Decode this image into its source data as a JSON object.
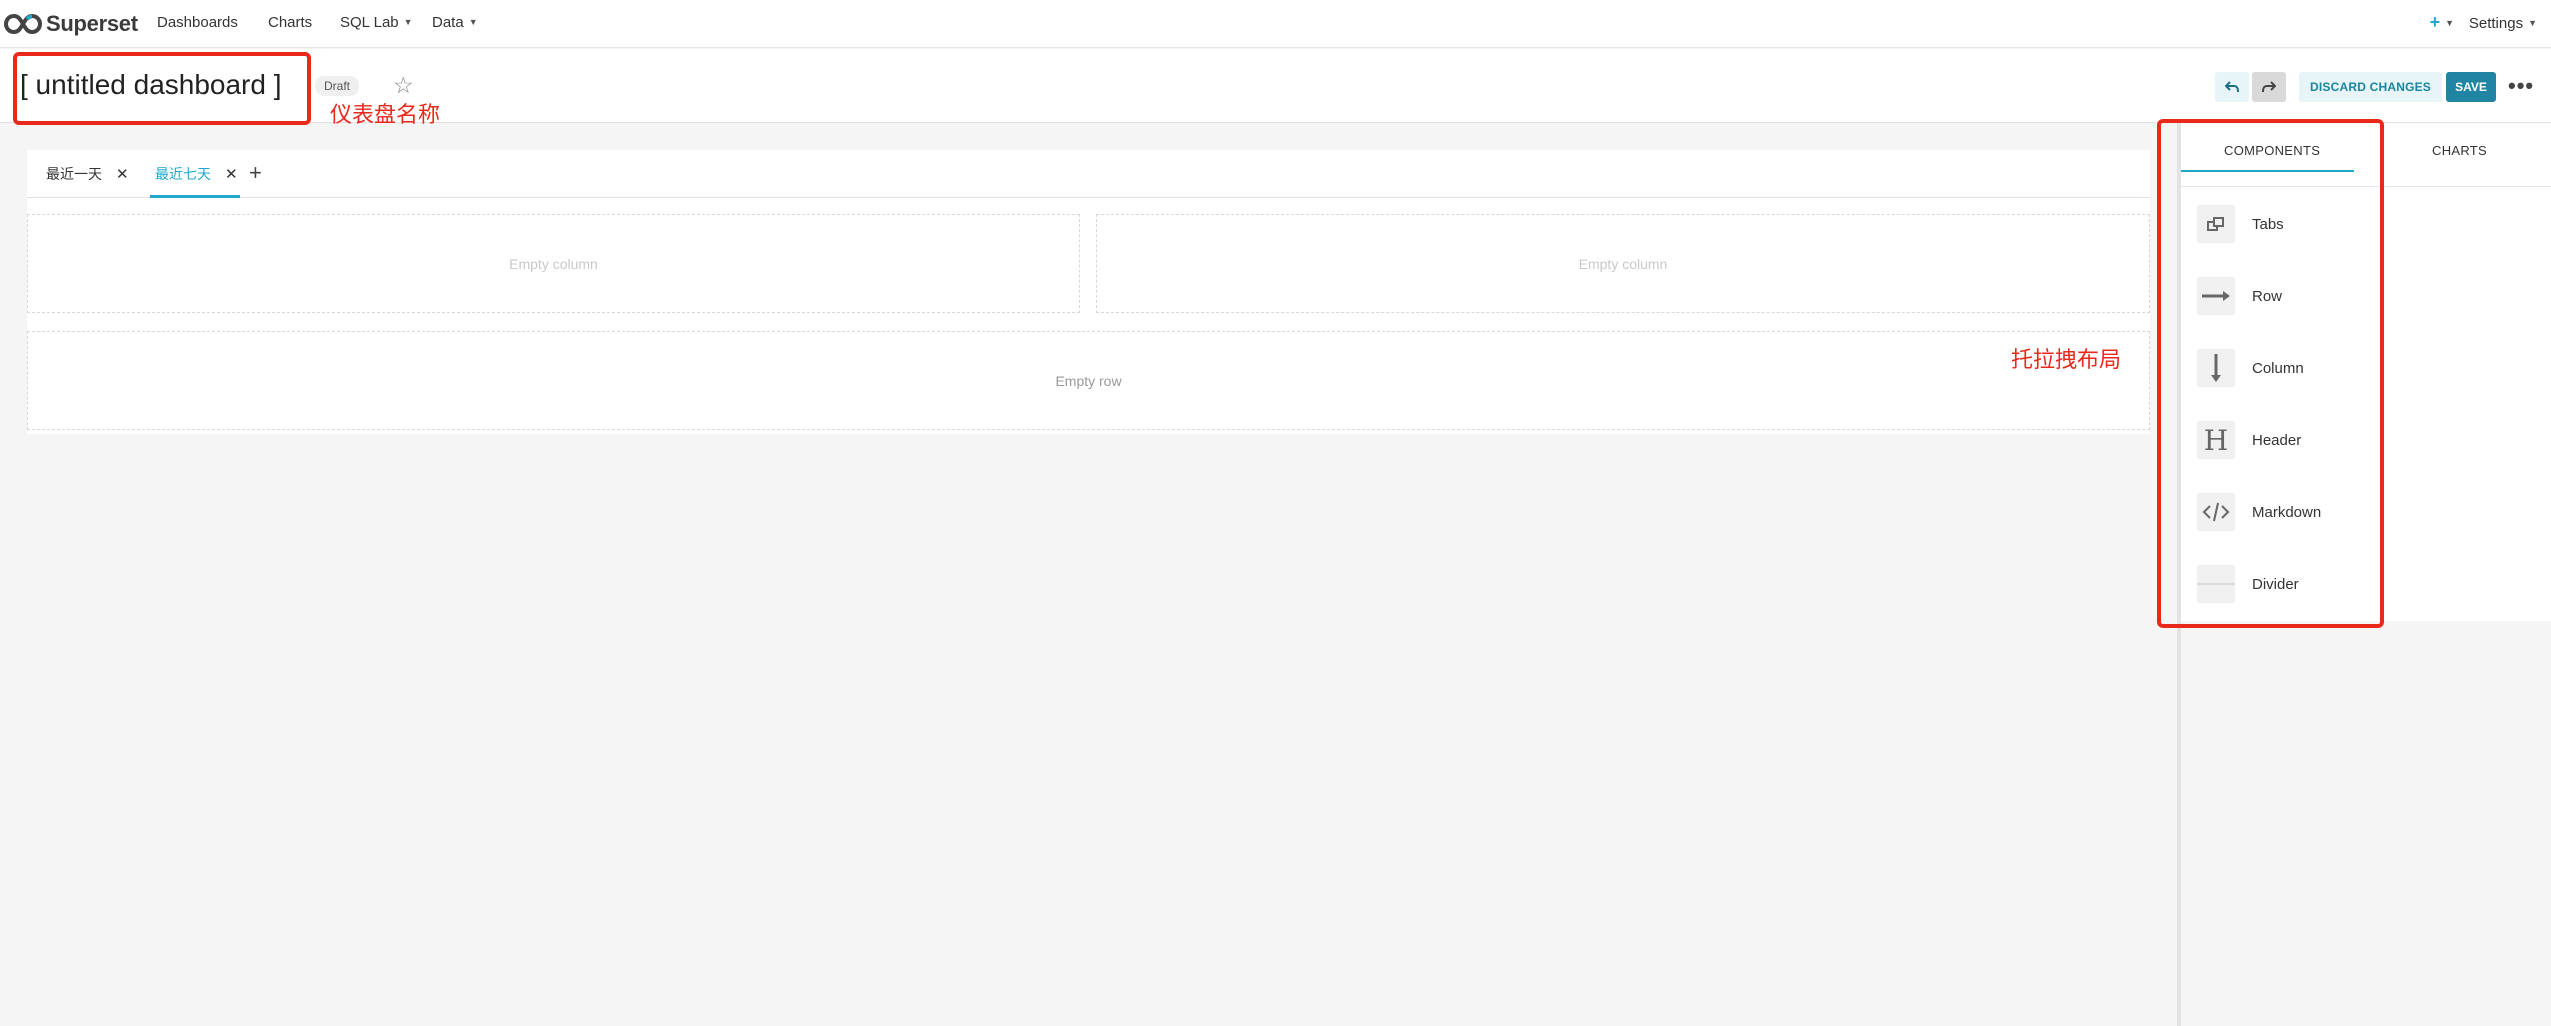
{
  "navbar": {
    "brand": "Superset",
    "menu": [
      {
        "label": "Dashboards"
      },
      {
        "label": "Charts"
      },
      {
        "label": "SQL Lab"
      },
      {
        "label": "Data"
      }
    ],
    "settings_label": "Settings"
  },
  "header": {
    "title": "[ untitled dashboard ]",
    "status_badge": "Draft",
    "discard_label": "DISCARD CHANGES",
    "save_label": "SAVE"
  },
  "annotations": {
    "title_note": "仪表盘名称",
    "panel_note": "托拉拽布局"
  },
  "dashboard": {
    "tabs": [
      {
        "label": "最近一天",
        "active": false
      },
      {
        "label": "最近七天",
        "active": true
      }
    ],
    "empty_column_label": "Empty column",
    "empty_row_label": "Empty row"
  },
  "side_panel": {
    "tabs": [
      {
        "label": "COMPONENTS",
        "active": true
      },
      {
        "label": "CHARTS",
        "active": false
      }
    ],
    "components": [
      {
        "label": "Tabs",
        "icon": "tabs-icon"
      },
      {
        "label": "Row",
        "icon": "row-icon"
      },
      {
        "label": "Column",
        "icon": "column-icon"
      },
      {
        "label": "Header",
        "icon": "header-icon"
      },
      {
        "label": "Markdown",
        "icon": "markdown-icon"
      },
      {
        "label": "Divider",
        "icon": "divider-icon"
      }
    ]
  },
  "colors": {
    "accent": "#20a7c9",
    "annotation": "#e8291c"
  }
}
